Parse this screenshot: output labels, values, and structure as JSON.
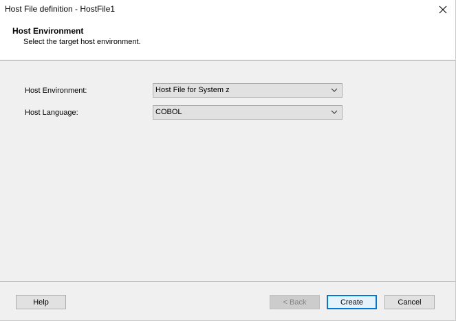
{
  "window": {
    "title": "Host File definition - HostFile1"
  },
  "header": {
    "title": "Host Environment",
    "subtitle": "Select the target host environment."
  },
  "form": {
    "host_environment": {
      "label": "Host Environment:",
      "value": "Host File for System z"
    },
    "host_language": {
      "label": "Host Language:",
      "value": "COBOL"
    }
  },
  "footer": {
    "help_label": "Help",
    "back_label": "< Back",
    "create_label": "Create",
    "cancel_label": "Cancel"
  },
  "icons": {
    "close": "close-icon",
    "dropdown": "chevron-down-icon"
  },
  "colors": {
    "accent": "#0078d7",
    "dialog_bg": "#f0f0f0",
    "header_bg": "#ffffff"
  }
}
